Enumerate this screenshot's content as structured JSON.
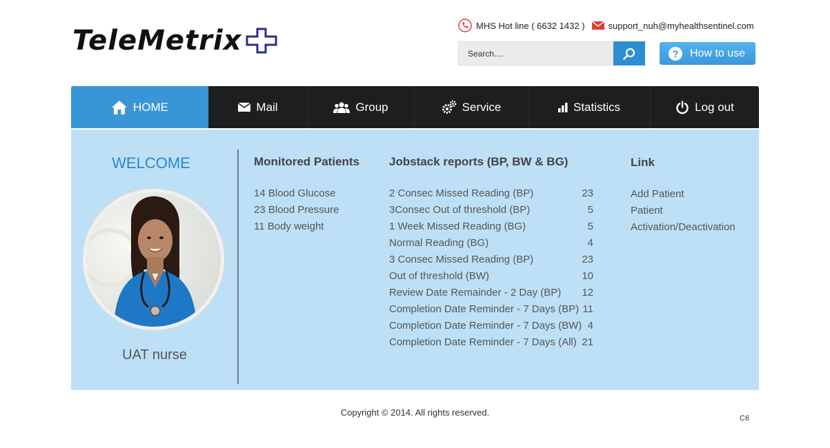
{
  "logo": {
    "text": "TeleMetrix",
    "cross_color": "#2b2c8f"
  },
  "contact": {
    "hotline": "MHS Hot line ( 6632 1432 )",
    "email": "support_nuh@myhealthsentinel.com"
  },
  "search": {
    "placeholder": "Search...."
  },
  "help": {
    "label": "How to use"
  },
  "nav": {
    "items": [
      {
        "label": "HOME",
        "icon": "home-icon"
      },
      {
        "label": "Mail",
        "icon": "envelope-icon"
      },
      {
        "label": "Group",
        "icon": "group-icon"
      },
      {
        "label": "Service",
        "icon": "gears-icon"
      },
      {
        "label": "Statistics",
        "icon": "bar-chart-icon"
      },
      {
        "label": "Log out",
        "icon": "power-icon"
      }
    ],
    "active_color": "#3896d6"
  },
  "profile": {
    "welcome": "WELCOME",
    "name": "UAT nurse"
  },
  "monitored": {
    "title": "Monitored Patients",
    "items": [
      "14 Blood Glucose",
      "23 Blood Pressure",
      "11 Body weight"
    ]
  },
  "jobstack": {
    "title": "Jobstack reports (BP, BW & BG)",
    "rows": [
      {
        "label": "2 Consec Missed Reading (BP)",
        "count": "23"
      },
      {
        "label": "3Consec Out of threshold (BP)",
        "count": "5"
      },
      {
        "label": "1 Week Missed Reading (BG)",
        "count": "5"
      },
      {
        "label": "Normal Reading (BG)",
        "count": "4"
      },
      {
        "label": "3 Consec Missed Reading (BP)",
        "count": "23"
      },
      {
        "label": "Out of threshold (BW)",
        "count": "10"
      },
      {
        "label": "Review Date Remainder - 2 Day (BP)",
        "count": "12"
      },
      {
        "label": "Completion Date Reminder - 7 Days (BP)",
        "count": "11"
      },
      {
        "label": "Completion Date Reminder - 7 Days (BW)",
        "count": "4"
      },
      {
        "label": "Completion Date Reminder - 7 Days (All)",
        "count": "21"
      }
    ]
  },
  "links": {
    "title": "Link",
    "items": [
      "Add Patient",
      "Patient",
      "Activation/Deactivation"
    ]
  },
  "footer": {
    "copyright": "Copyright © 2014. All rights reserved.",
    "version": "C6"
  }
}
